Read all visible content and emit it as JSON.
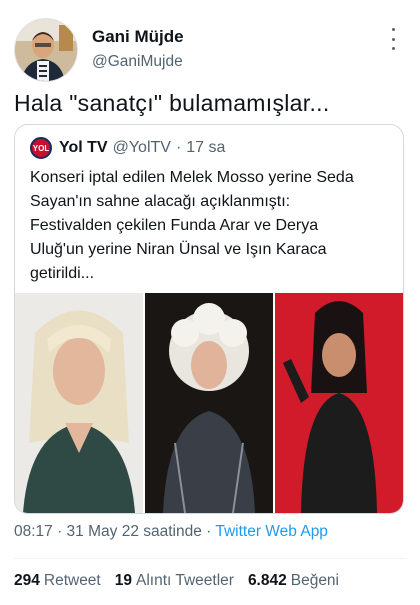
{
  "author": {
    "name": "Gani Müjde",
    "handle": "@GaniMujde",
    "avatar_icon": "person-avatar"
  },
  "more_icon": "three-dots-vertical-icon",
  "tweet": {
    "text": "Hala \"sanatçı\" bulamamışlar..."
  },
  "quoted": {
    "logo_text": "YOL",
    "name": "Yol TV",
    "handle": "@YolTV",
    "separator": "·",
    "time": "17 sa",
    "lines": [
      "Konseri iptal edilen Melek Mosso yerine Seda",
      "Sayan'ın sahne alacağı açıklanmıştı:",
      "Festivalden çekilen Funda Arar ve Derya",
      "Uluğ'un yerine Niran Ünsal ve Işın Karaca",
      "getirildi..."
    ]
  },
  "meta": {
    "timestamp": "08:17 · 31 May 22 saatinde ·",
    "app": "Twitter Web App"
  },
  "stats": [
    {
      "count": "294",
      "label": "Retweet"
    },
    {
      "count": "19",
      "label": "Alıntı Tweetler"
    },
    {
      "count": "6.842",
      "label": "Beğeni"
    }
  ],
  "colors": {
    "link": "#1d9bf0",
    "muted": "#536471",
    "border": "#cfd9de"
  }
}
